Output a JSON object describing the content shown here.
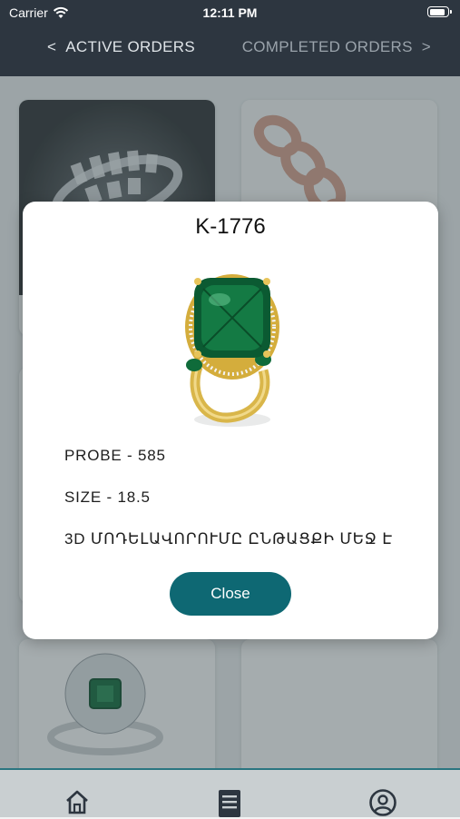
{
  "status_bar": {
    "carrier": "Carrier",
    "time": "12:11 PM",
    "battery_level": 0.9
  },
  "tabs": {
    "active": {
      "chevron": "<",
      "label": "ACTIVE ORDERS"
    },
    "completed": {
      "label": "COMPLETED ORDERS",
      "chevron": ">"
    }
  },
  "modal": {
    "title": "K-1776",
    "probe": "PROBE - 585",
    "size": "SIZE - 18.5",
    "status": "3D ՄՈԴԵԼԱՎՈՐՈՒՄԸ ԸՆԹԱՑՔԻ ՄԵՋ Է",
    "close_label": "Close"
  },
  "bottom_nav": {
    "items": [
      "home-icon",
      "orders-icon",
      "profile-icon"
    ]
  },
  "colors": {
    "header": "#2d3640",
    "accent": "#0e6873",
    "emerald": "#0f6b3a",
    "gold": "#d4ad3c"
  }
}
